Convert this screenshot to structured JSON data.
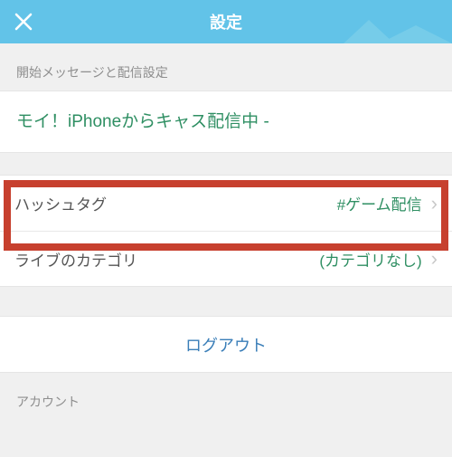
{
  "header": {
    "title": "設定"
  },
  "section1": {
    "header": "開始メッセージと配信設定",
    "message": "モイ！iPhoneからキャス配信中 -"
  },
  "rows": {
    "hashtag": {
      "label": "ハッシュタグ",
      "value": "#ゲーム配信"
    },
    "category": {
      "label": "ライブのカテゴリ",
      "value": "(カテゴリなし)"
    }
  },
  "logout": {
    "label": "ログアウト"
  },
  "section2": {
    "header": "アカウント"
  },
  "colors": {
    "accent": "#2f8f63",
    "header_bg": "#62c3e8",
    "highlight": "#c7402e"
  }
}
